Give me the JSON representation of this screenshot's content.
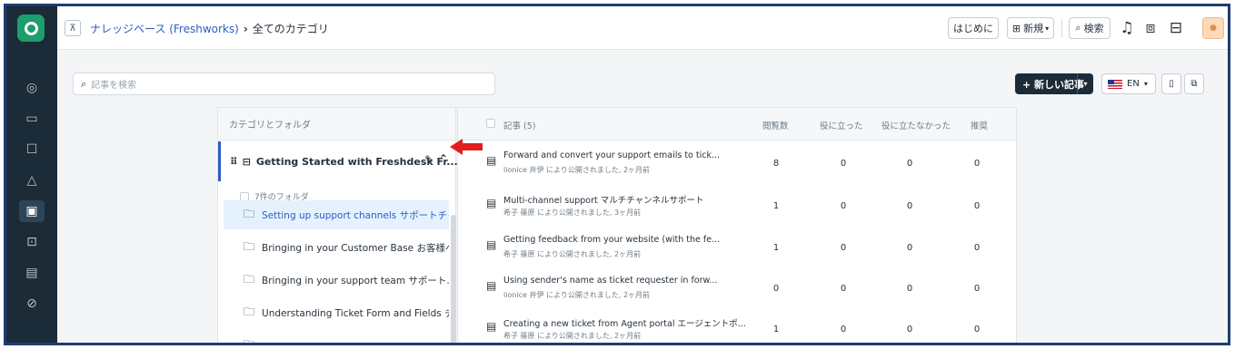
{
  "breadcrumb": {
    "link": "ナレッジベース (Freshworks)",
    "separator": "›",
    "current": "全てのカテゴリ"
  },
  "topbar": {
    "getting_started": "はじめに",
    "new_label": "新規",
    "search_label": "検索"
  },
  "search": {
    "placeholder": "記事を検索"
  },
  "actions": {
    "new_article": "+ 新しい記事",
    "language": "EN"
  },
  "categories": {
    "header": "カテゴリとフォルダ",
    "selected_category": "Getting Started with Freshdesk  Fr...",
    "folder_count": "7件のフォルダ",
    "folders": [
      {
        "label": "Setting up support channels  サポートチャ..."
      },
      {
        "label": "Bringing in your Customer Base   お客様べ..."
      },
      {
        "label": "Bringing in your support team   サポート..."
      },
      {
        "label": "Understanding Ticket Form and Fields   チ..."
      },
      {
        "label": ""
      }
    ]
  },
  "articles": {
    "columns": {
      "title": "記事 (5)",
      "views": "閲覧数",
      "helpful": "役に立った",
      "not_helpful": "役に立たなかった",
      "recommend": "推奨"
    },
    "rows": [
      {
        "title": "Forward and convert your support emails to tick...",
        "meta": "lionice 井伊 により公開されました, 2ヶ月前",
        "views": "8",
        "helpful": "0",
        "not_helpful": "0",
        "recommend": "0"
      },
      {
        "title": "Multi-channel support  マルチチャンネルサポート",
        "meta": "希子 篠原 により公開されました, 3ヶ月前",
        "views": "1",
        "helpful": "0",
        "not_helpful": "0",
        "recommend": "0"
      },
      {
        "title": "Getting feedback from your website (with the fe...",
        "meta": "希子 篠原 により公開されました, 2ヶ月前",
        "views": "1",
        "helpful": "0",
        "not_helpful": "0",
        "recommend": "0"
      },
      {
        "title": "Using sender's name as ticket requester in forw...",
        "meta": "lionice 井伊 により公開されました, 2ヶ月前",
        "views": "0",
        "helpful": "0",
        "not_helpful": "0",
        "recommend": "0"
      },
      {
        "title": "Creating a new ticket from Agent portal エージェントポ...",
        "meta": "希子 篠原 により公開されました, 2ヶ月前",
        "views": "1",
        "helpful": "0",
        "not_helpful": "0",
        "recommend": "0"
      }
    ]
  },
  "colors": {
    "sidebar": "#1b2b38",
    "brand": "#1d9e6c",
    "link": "#2c5cc5",
    "arrow": "#e01e1e",
    "selected_folder_bg": "#e5f2fd"
  }
}
